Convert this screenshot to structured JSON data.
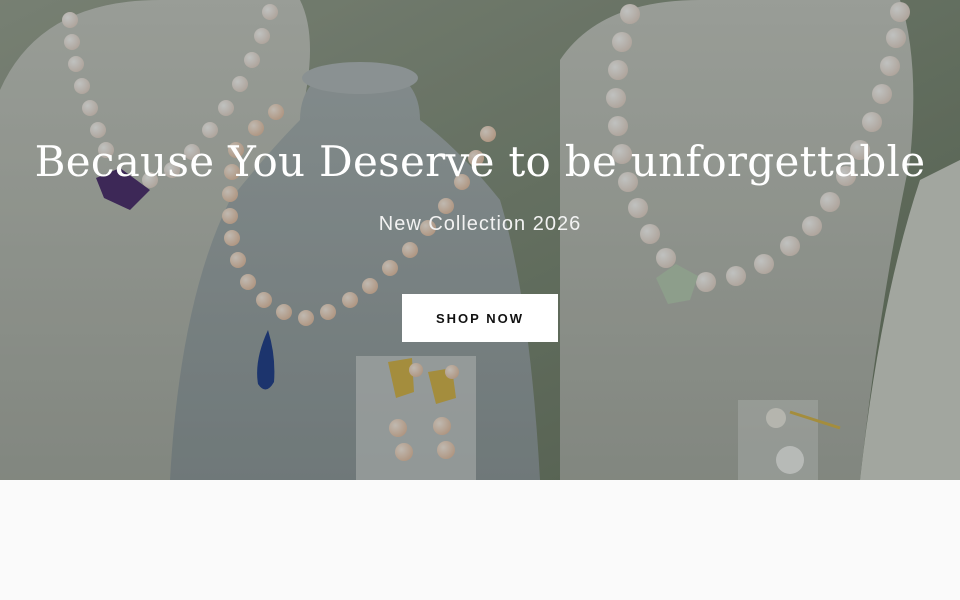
{
  "hero": {
    "headline": "Because You Deserve to be unforgettable",
    "subheadline": "New Collection 2026",
    "cta_label": "SHOP NOW",
    "image": "jewelry-display-photo"
  },
  "colors": {
    "overlay": "#1e231e",
    "button_bg": "#ffffff",
    "button_text": "#111111",
    "page_bg": "#fafafa"
  }
}
